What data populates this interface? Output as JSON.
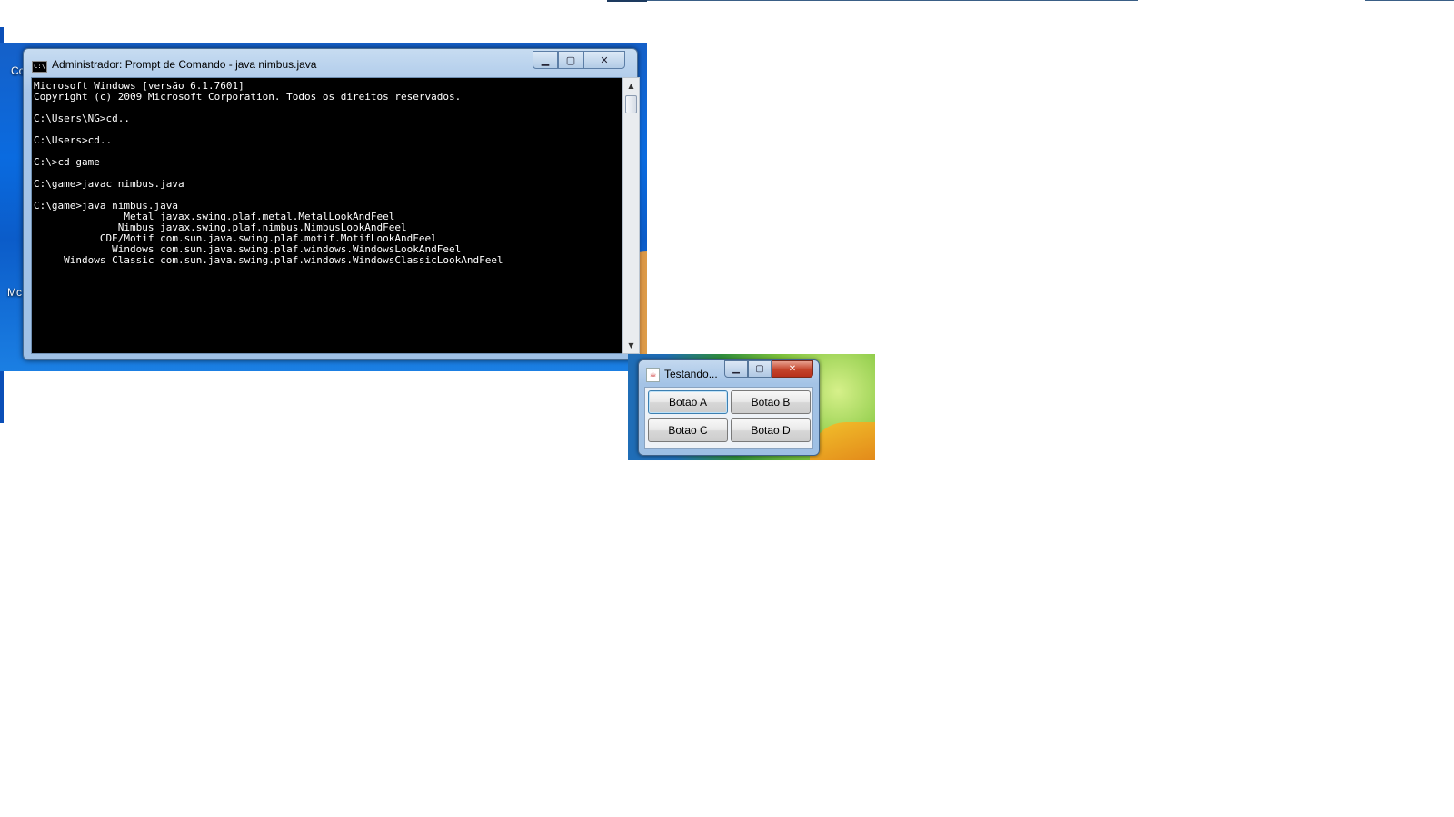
{
  "desktop": {
    "labels": [
      "Co",
      "Mc"
    ]
  },
  "cmd_window": {
    "title": "Administrador: Prompt de Comando - java  nimbus.java",
    "icon_text": "C:\\",
    "buttons": {
      "minimize": "▁",
      "maximize": "▢",
      "close": "✕"
    },
    "console_lines": [
      "Microsoft Windows [versão 6.1.7601]",
      "Copyright (c) 2009 Microsoft Corporation. Todos os direitos reservados.",
      "",
      "C:\\Users\\NG>cd..",
      "",
      "C:\\Users>cd..",
      "",
      "C:\\>cd game",
      "",
      "C:\\game>javac nimbus.java",
      "",
      "C:\\game>java nimbus.java",
      "               Metal javax.swing.plaf.metal.MetalLookAndFeel",
      "              Nimbus javax.swing.plaf.nimbus.NimbusLookAndFeel",
      "           CDE/Motif com.sun.java.swing.plaf.motif.MotifLookAndFeel",
      "             Windows com.sun.java.swing.plaf.windows.WindowsLookAndFeel",
      "     Windows Classic com.sun.java.swing.plaf.windows.WindowsClassicLookAndFeel"
    ],
    "scrollbar": {
      "up": "▲",
      "down": "▼"
    }
  },
  "java_window": {
    "title": "Testando...",
    "icon": "☕",
    "buttons": {
      "minimize": "▁",
      "maximize": "▢",
      "close": "✕"
    },
    "panel_buttons": {
      "a": "Botao A",
      "b": "Botao B",
      "c": "Botao C",
      "d": "Botao D"
    }
  },
  "colors": {
    "console_bg": "#000000",
    "console_fg": "#ffffff",
    "aero_frame": "#a7c5e8",
    "close_red": "#c4432a"
  }
}
